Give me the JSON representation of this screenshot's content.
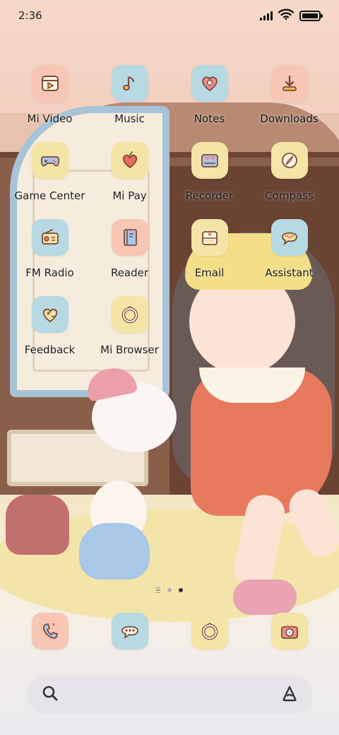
{
  "status_bar": {
    "time": "2:36",
    "icons": [
      "signal-icon",
      "wifi-icon",
      "battery-icon"
    ],
    "battery_level": 1.0
  },
  "apps": [
    {
      "label": "Mi Video",
      "icon": "mi-video-icon",
      "tile_color": "#f8c6b4"
    },
    {
      "label": "Music",
      "icon": "music-note-icon",
      "tile_color": "#b6d9e2"
    },
    {
      "label": "Notes",
      "icon": "notes-heart-icon",
      "tile_color": "#b6d9e2"
    },
    {
      "label": "Downloads",
      "icon": "download-icon",
      "tile_color": "#f8c6b4"
    },
    {
      "label": "Game Center",
      "icon": "gamepad-icon",
      "tile_color": "#f4e4a6"
    },
    {
      "label": "Mi Pay",
      "icon": "heart-wallet-icon",
      "tile_color": "#f4e4a6"
    },
    {
      "label": "Recorder",
      "icon": "recorder-icon",
      "tile_color": "#f4e4a6"
    },
    {
      "label": "Compass",
      "icon": "compass-icon",
      "tile_color": "#f4e4a6"
    },
    {
      "label": "FM Radio",
      "icon": "radio-icon",
      "tile_color": "#b6d9e2"
    },
    {
      "label": "Reader",
      "icon": "book-icon",
      "tile_color": "#f8c6b4"
    },
    {
      "label": "Email",
      "icon": "email-icon",
      "tile_color": "#f4e4a6"
    },
    {
      "label": "Assistant",
      "icon": "assistant-bubble-icon",
      "tile_color": "#b6d9e2"
    },
    {
      "label": "Feedback",
      "icon": "feedback-heart-icon",
      "tile_color": "#b6d9e2"
    },
    {
      "label": "Mi Browser",
      "icon": "browser-ring-icon",
      "tile_color": "#f4e4a6"
    }
  ],
  "page_indicator": {
    "pages": 2,
    "active_page": 2
  },
  "dock": [
    {
      "icon": "phone-icon",
      "tile_color": "#f8c6b4"
    },
    {
      "icon": "messages-icon",
      "tile_color": "#b6d9e2"
    },
    {
      "icon": "browser-ring-icon",
      "tile_color": "#f4e4a6"
    },
    {
      "icon": "camera-icon",
      "tile_color": "#f4e4a6"
    }
  ],
  "search_bar": {
    "left_icon": "search-icon",
    "right_icon": "assistant-a-icon",
    "placeholder": ""
  }
}
